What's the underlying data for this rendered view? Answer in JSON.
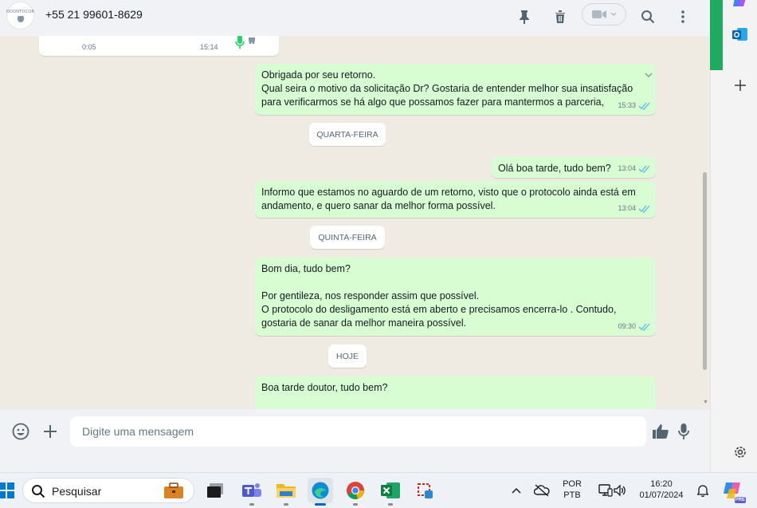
{
  "header": {
    "avatar_logo": "ODONTOCOR",
    "contact_name": "+55 21 99601-8629"
  },
  "voice_message": {
    "duration": "0:05",
    "time": "15:14"
  },
  "messages": [
    {
      "text": "Obrigada por seu retorno.\nQual seira o motivo da solicitação Dr? Gostaria de entender melhor sua insatisfação\npara verificarmos se há algo que possamos fazer para mantermos a parceria,",
      "time": "15:33"
    },
    {
      "text": "Olá boa tarde, tudo bem?",
      "time": "13:04"
    },
    {
      "text": "Informo que estamos no aguardo de um retorno, visto que o protocolo ainda está em\nandamento, e quero sanar da melhor forma possível.",
      "time": "13:04"
    },
    {
      "text": "Bom dia, tudo bem?\n\nPor gentileza, nos responder assim que possível.\nO protocolo do desligamento está em aberto e precisamos encerra-lo . Contudo,\ngostaria de sanar da melhor maneira possível.",
      "time": "09:30"
    },
    {
      "text": "Boa tarde doutor, tudo bem?",
      "time": ""
    }
  ],
  "date_chips": [
    "QUARTA-FEIRA",
    "QUINTA-FEIRA",
    "HOJE"
  ],
  "composer": {
    "placeholder": "Digite uma mensagem"
  },
  "taskbar": {
    "search_label": "Pesquisar",
    "lang_top": "POR",
    "lang_bottom": "PTB",
    "time": "16:20",
    "date": "01/07/2024",
    "copilot_badge": "PRE"
  },
  "colors": {
    "outgoing_bubble": "#d9fdd3",
    "chat_background": "#efeae2",
    "accent_green": "#1daa61",
    "read_ticks": "#53bdeb"
  }
}
